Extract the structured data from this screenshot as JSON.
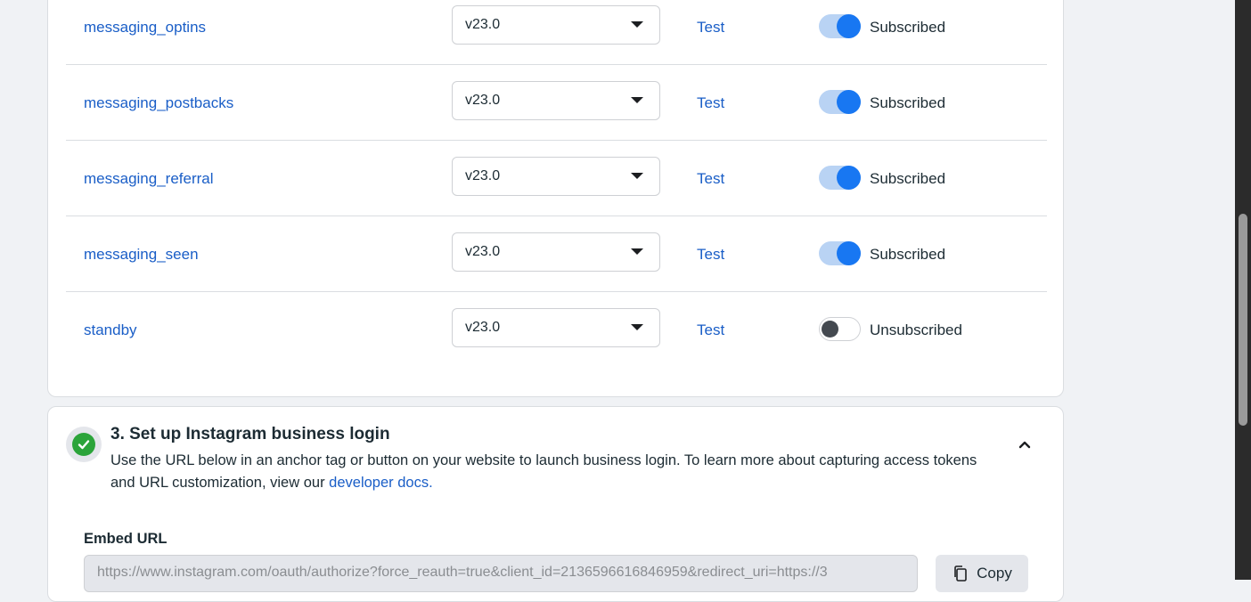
{
  "webhook_fields": [
    {
      "name": "messaging_optins",
      "version": "v23.0",
      "test_label": "Test",
      "subscribed": true,
      "status": "Subscribed"
    },
    {
      "name": "messaging_postbacks",
      "version": "v23.0",
      "test_label": "Test",
      "subscribed": true,
      "status": "Subscribed"
    },
    {
      "name": "messaging_referral",
      "version": "v23.0",
      "test_label": "Test",
      "subscribed": true,
      "status": "Subscribed"
    },
    {
      "name": "messaging_seen",
      "version": "v23.0",
      "test_label": "Test",
      "subscribed": true,
      "status": "Subscribed"
    },
    {
      "name": "standby",
      "version": "v23.0",
      "test_label": "Test",
      "subscribed": false,
      "status": "Unsubscribed"
    }
  ],
  "login_section": {
    "title": "3. Set up Instagram business login",
    "description": "Use the URL below in an anchor tag or button on your website to launch business login. To learn more about capturing access tokens and URL customization, view our ",
    "docs_link": "developer docs.",
    "embed_label": "Embed URL",
    "embed_url": "https://www.instagram.com/oauth/authorize?force_reauth=true&client_id=2136596616846959&redirect_uri=https://3",
    "copy_label": "Copy",
    "completed": true
  },
  "colors": {
    "link": "#1a5ec7",
    "toggle_on": "#1877f2",
    "success": "#2ba43a"
  },
  "icons": [
    "chevron-down-icon",
    "check-circle-icon",
    "chevron-up-icon",
    "copy-icon"
  ]
}
